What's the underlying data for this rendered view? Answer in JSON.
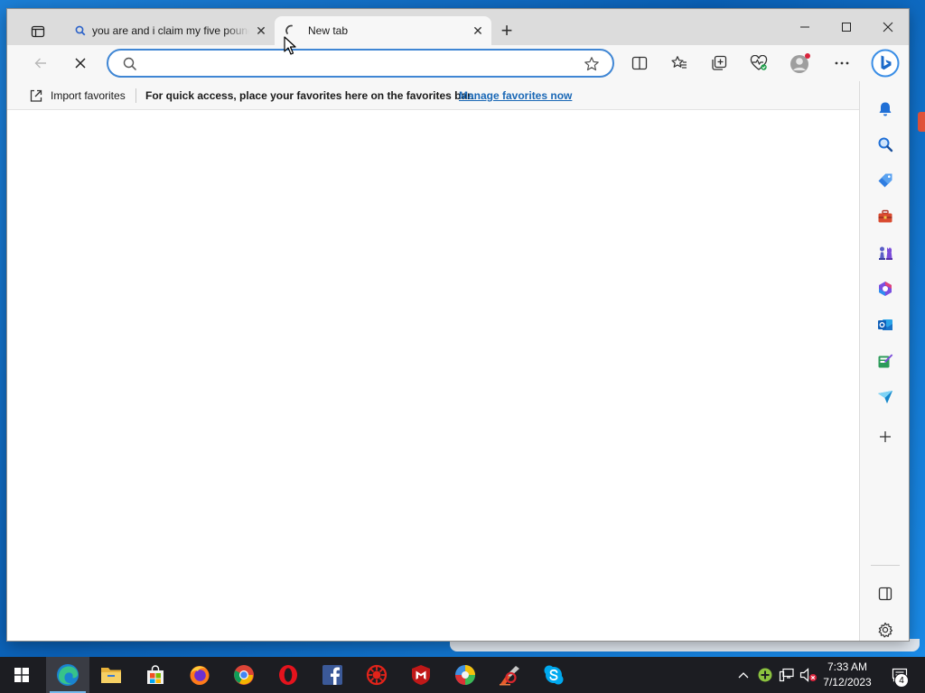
{
  "browser": {
    "tabs": [
      {
        "title": "you are and i claim my five pounds",
        "favicon": "search-icon",
        "active": false
      },
      {
        "title": "New tab",
        "favicon": "loading-spinner-icon",
        "active": true
      }
    ],
    "address_bar": {
      "value": "",
      "placeholder": ""
    },
    "favorites_bar": {
      "import_label": "Import favorites",
      "message": "For quick access, place your favorites here on the favorites bar.",
      "manage_link": "Manage favorites now"
    },
    "sidebar_items": [
      "bell-icon",
      "search-icon",
      "tag-icon",
      "toolbox-icon",
      "games-icon",
      "microsoft-365-icon",
      "outlook-icon",
      "drop-icon",
      "send-icon",
      "add-icon"
    ],
    "colors": {
      "accent": "#3f86d4",
      "link": "#1a68b6"
    }
  },
  "taskbar": {
    "apps": [
      "edge-icon",
      "file-explorer-icon",
      "store-icon",
      "firefox-icon",
      "chrome-icon",
      "opera-icon",
      "facebook-icon",
      "virus-shield-icon",
      "mcafee-icon",
      "picasa-icon",
      "ccleaner-icon",
      "skype-icon"
    ],
    "time": "7:33 AM",
    "date": "7/12/2023",
    "notification_count": "4"
  }
}
